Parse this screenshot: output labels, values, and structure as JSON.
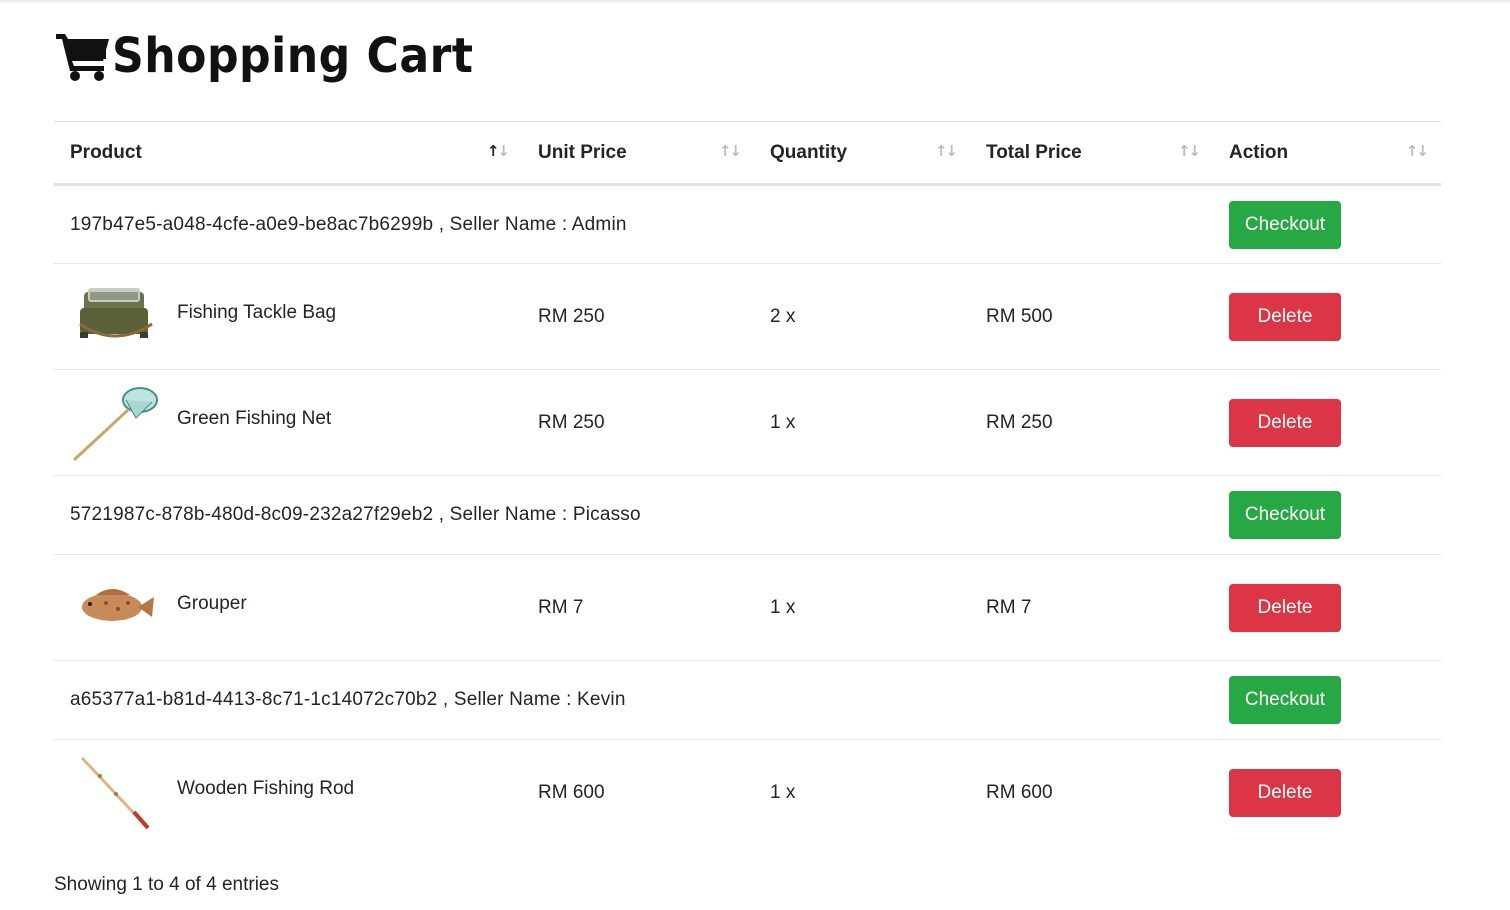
{
  "page": {
    "title": "Shopping Cart",
    "icon": "shopping-cart-icon"
  },
  "table": {
    "columns": [
      {
        "label": "Product"
      },
      {
        "label": "Unit Price"
      },
      {
        "label": "Quantity"
      },
      {
        "label": "Total Price"
      },
      {
        "label": "Action"
      }
    ],
    "groups": [
      {
        "seller_line": "197b47e5-a048-4cfe-a0e9-be8ac7b6299b , Seller Name : Admin",
        "checkout_label": "Checkout",
        "items": [
          {
            "name": "Fishing Tackle Bag",
            "unit_price": "RM 250",
            "quantity": "2 x",
            "total_price": "RM 500",
            "action": "Delete",
            "image": "tackle-bag-image"
          },
          {
            "name": "Green Fishing Net",
            "unit_price": "RM 250",
            "quantity": "1 x",
            "total_price": "RM 250",
            "action": "Delete",
            "image": "fishing-net-image"
          }
        ]
      },
      {
        "seller_line": "5721987c-878b-480d-8c09-232a27f29eb2 , Seller Name : Picasso",
        "checkout_label": "Checkout",
        "items": [
          {
            "name": "Grouper",
            "unit_price": "RM 7",
            "quantity": "1 x",
            "total_price": "RM 7",
            "action": "Delete",
            "image": "grouper-fish-image"
          }
        ]
      },
      {
        "seller_line": "a65377a1-b81d-4413-8c71-1c14072c70b2 , Seller Name : Kevin",
        "checkout_label": "Checkout",
        "items": [
          {
            "name": "Wooden Fishing Rod",
            "unit_price": "RM 600",
            "quantity": "1 x",
            "total_price": "RM 600",
            "action": "Delete",
            "image": "fishing-rod-image"
          }
        ]
      }
    ]
  },
  "footer": {
    "info": "Showing 1 to 4 of 4 entries"
  },
  "colors": {
    "checkout": "#28a745",
    "delete": "#dc3545",
    "border": "#dee2e6"
  }
}
